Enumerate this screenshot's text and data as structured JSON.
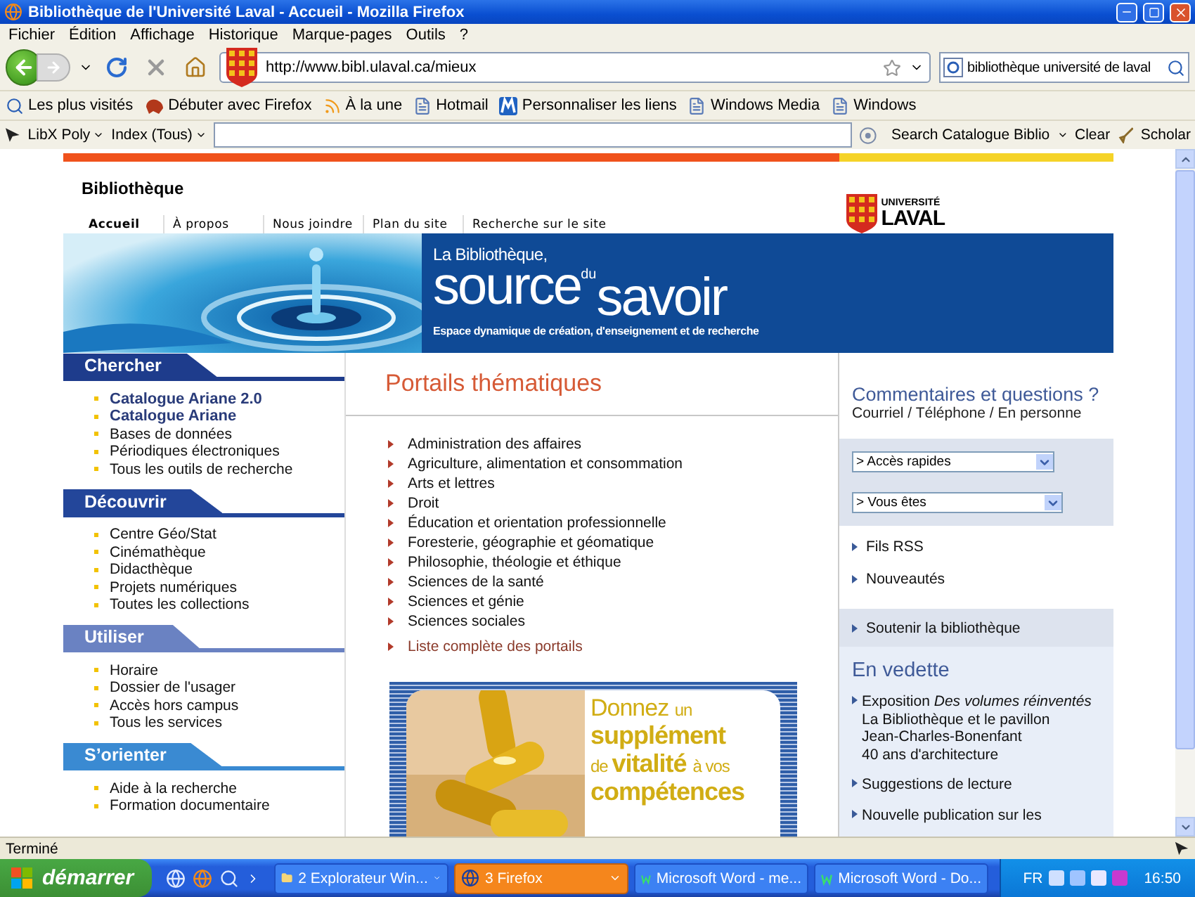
{
  "window": {
    "title": "Bibliothèque de l'Université Laval - Accueil - Mozilla Firefox"
  },
  "menu": [
    "Fichier",
    "Édition",
    "Affichage",
    "Historique",
    "Marque-pages",
    "Outils",
    "?"
  ],
  "navbar": {
    "url": "http://www.bibl.ulaval.ca/mieux",
    "search": "bibliothèque université de laval"
  },
  "bookmarks": [
    {
      "label": "Les plus visités",
      "kind": "search"
    },
    {
      "label": "Débuter avec Firefox",
      "kind": "pet"
    },
    {
      "label": "À la une",
      "kind": "rss"
    },
    {
      "label": "Hotmail",
      "kind": "page"
    },
    {
      "label": "Personnaliser les liens",
      "kind": "logo"
    },
    {
      "label": "Windows Media",
      "kind": "page"
    },
    {
      "label": "Windows",
      "kind": "page"
    }
  ],
  "libx": {
    "edition": "LibX Poly",
    "scope": "Index (Tous)",
    "search_button": "Search Catalogue Biblio",
    "clear": "Clear",
    "scholar": "Scholar"
  },
  "page": {
    "site_title": "Bibliothèque",
    "logo": {
      "top": "UNIVERSITÉ",
      "bottom": "LAVAL"
    },
    "tabs": [
      {
        "label": "Accueil",
        "selected": true
      },
      {
        "label": "À propos",
        "selected": false
      },
      {
        "label": "Nous joindre",
        "selected": false
      },
      {
        "label": "Plan du site",
        "selected": false
      },
      {
        "label": "Recherche sur le site",
        "selected": false
      }
    ],
    "banner": {
      "kicker": "La Bibliothèque,",
      "word1": "source",
      "small": "du",
      "word2": "savoir",
      "tagline": "Espace dynamique de création, d'enseignement et de recherche"
    },
    "sections": [
      {
        "title": "Chercher",
        "color": "#1e3c8c",
        "items": [
          {
            "label": "Catalogue Ariane 2.0",
            "emphasis": true
          },
          {
            "label": "Catalogue Ariane",
            "emphasis": true
          },
          {
            "label": "Bases de données",
            "emphasis": false
          },
          {
            "label": "Périodiques électroniques",
            "emphasis": false
          },
          {
            "label": "Tous les outils de recherche",
            "emphasis": false
          }
        ]
      },
      {
        "title": "Découvrir",
        "color": "#23469a",
        "items": [
          {
            "label": "Centre Géo/Stat",
            "emphasis": false
          },
          {
            "label": "Cinémathèque",
            "emphasis": false
          },
          {
            "label": "Didacthèque",
            "emphasis": false
          },
          {
            "label": "Projets numériques",
            "emphasis": false
          },
          {
            "label": "Toutes les collections",
            "emphasis": false
          }
        ]
      },
      {
        "title": "Utiliser",
        "color": "#6a82c2",
        "items": [
          {
            "label": "Horaire",
            "emphasis": false
          },
          {
            "label": "Dossier de l'usager",
            "emphasis": false
          },
          {
            "label": "Accès hors campus",
            "emphasis": false
          },
          {
            "label": "Tous les services",
            "emphasis": false
          }
        ]
      },
      {
        "title": "S’orienter",
        "color": "#3a8ad2",
        "items": [
          {
            "label": "Aide à la recherche",
            "emphasis": false
          },
          {
            "label": "Formation documentaire",
            "emphasis": false
          }
        ]
      }
    ],
    "portals": {
      "title": "Portails thématiques",
      "items": [
        "Administration des affaires",
        "Agriculture, alimentation et consommation",
        "Arts et lettres",
        "Droit",
        "Éducation et orientation professionnelle",
        "Foresterie, géographie et géomatique",
        "Philosophie, théologie et éthique",
        "Sciences de la santé",
        "Sciences et génie",
        "Sciences sociales"
      ],
      "more": "Liste complète des portails"
    },
    "ad": {
      "lines": [
        [
          {
            "text": "Donnez",
            "kind": "large"
          },
          {
            "text": "un",
            "kind": "small"
          }
        ],
        [
          {
            "text": "supplément",
            "kind": "bold"
          }
        ],
        [
          {
            "text": "de",
            "kind": "small"
          },
          {
            "text": "vitalité",
            "kind": "bold"
          },
          {
            "text": "à vos",
            "kind": "small"
          }
        ],
        [
          {
            "text": "compétences",
            "kind": "bold"
          }
        ]
      ]
    },
    "feedback": {
      "title": "Commentaires et questions ?",
      "subtitle": "Courriel / Téléphone / En personne"
    },
    "selects": [
      "> Accès rapides",
      "> Vous êtes"
    ],
    "links": [
      "Fils RSS",
      "Nouveautés"
    ],
    "support": "Soutenir la bibliothèque",
    "featured": {
      "title": "En vedette",
      "items": [
        {
          "lines": [
            "Exposition *Des volumes réinventés*",
            "La Bibliothèque et le pavillon",
            "Jean-Charles-Bonenfant",
            "40 ans d'architecture"
          ]
        },
        {
          "lines": [
            "Suggestions de lecture"
          ]
        },
        {
          "lines": [
            "Nouvelle publication sur les"
          ]
        }
      ]
    }
  },
  "status": "Terminé",
  "taskbar": {
    "start": "démarrer",
    "tasks": [
      {
        "label": "2 Explorateur Win...",
        "kind": "folder",
        "selected": false
      },
      {
        "label": "3 Firefox",
        "kind": "browser",
        "selected": true
      },
      {
        "label": "Microsoft Word - me...",
        "kind": "word",
        "selected": false
      },
      {
        "label": "Microsoft Word - Do...",
        "kind": "word",
        "selected": false
      }
    ],
    "language": "FR",
    "clock": "16:50"
  }
}
